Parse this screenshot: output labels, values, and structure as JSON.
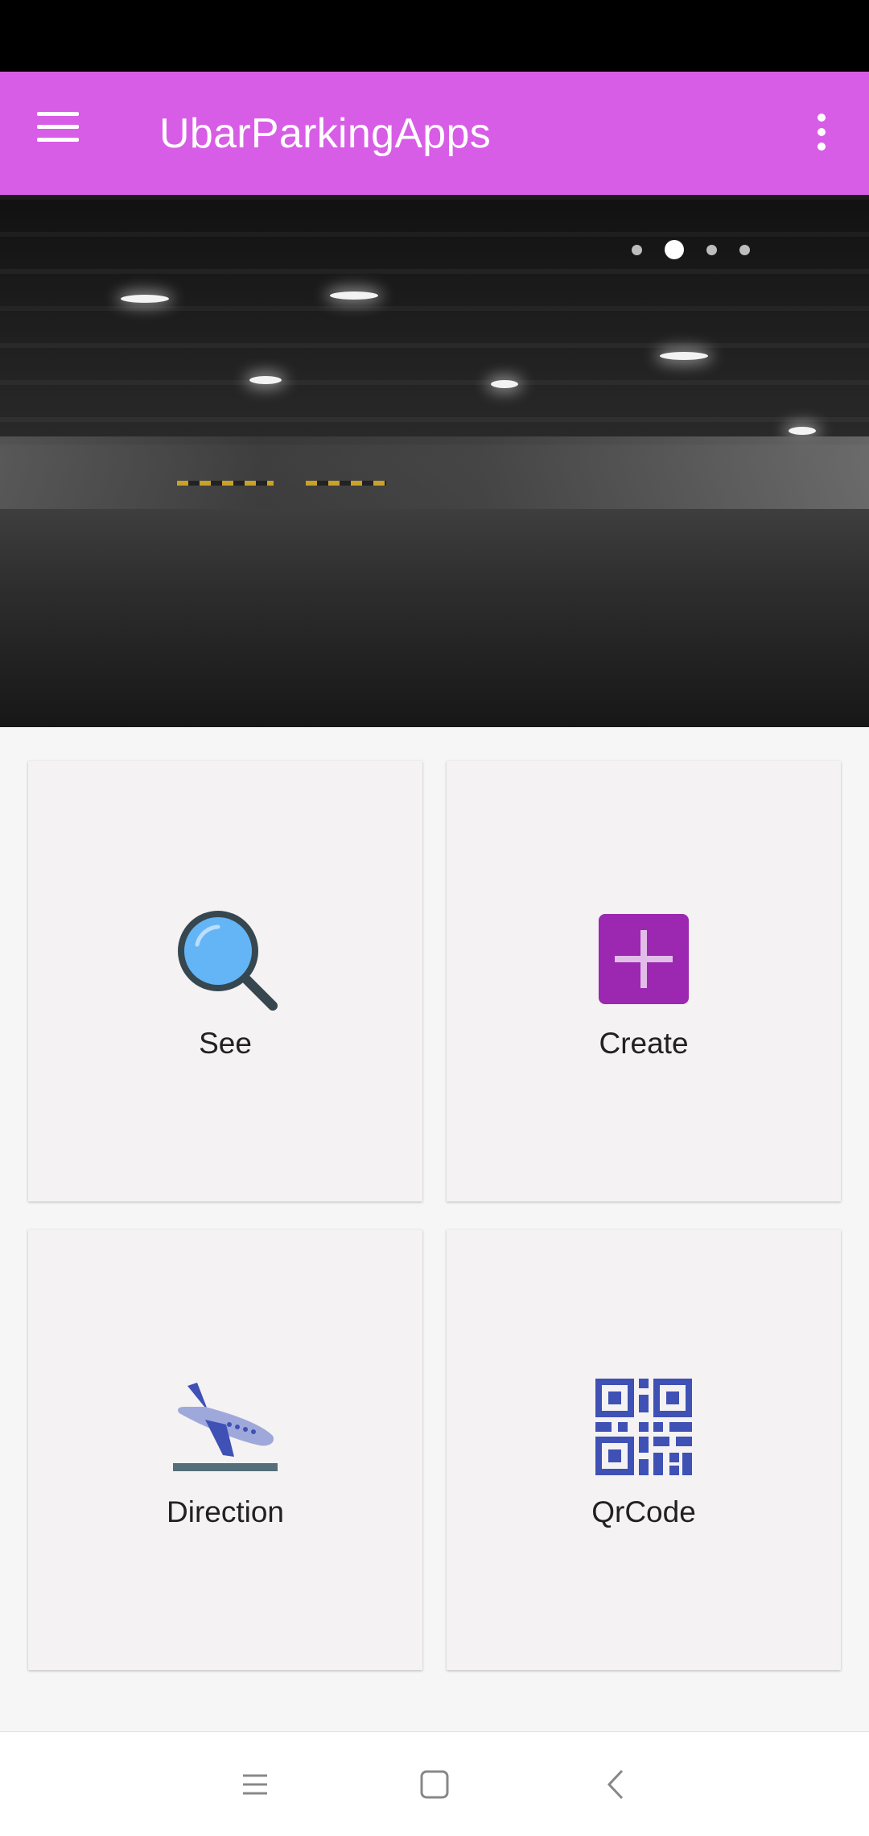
{
  "app": {
    "title": "UbarParkingApps",
    "accent_color": "#d85de6"
  },
  "carousel": {
    "page_count": 4,
    "active_index": 1
  },
  "tiles": [
    {
      "label": "See",
      "icon": "search-icon"
    },
    {
      "label": "Create",
      "icon": "add-box-icon"
    },
    {
      "label": "Direction",
      "icon": "airplane-landing-icon"
    },
    {
      "label": "QrCode",
      "icon": "qr-code-icon"
    }
  ],
  "nav": {
    "icons": [
      "recents-icon",
      "home-icon",
      "back-icon"
    ]
  }
}
